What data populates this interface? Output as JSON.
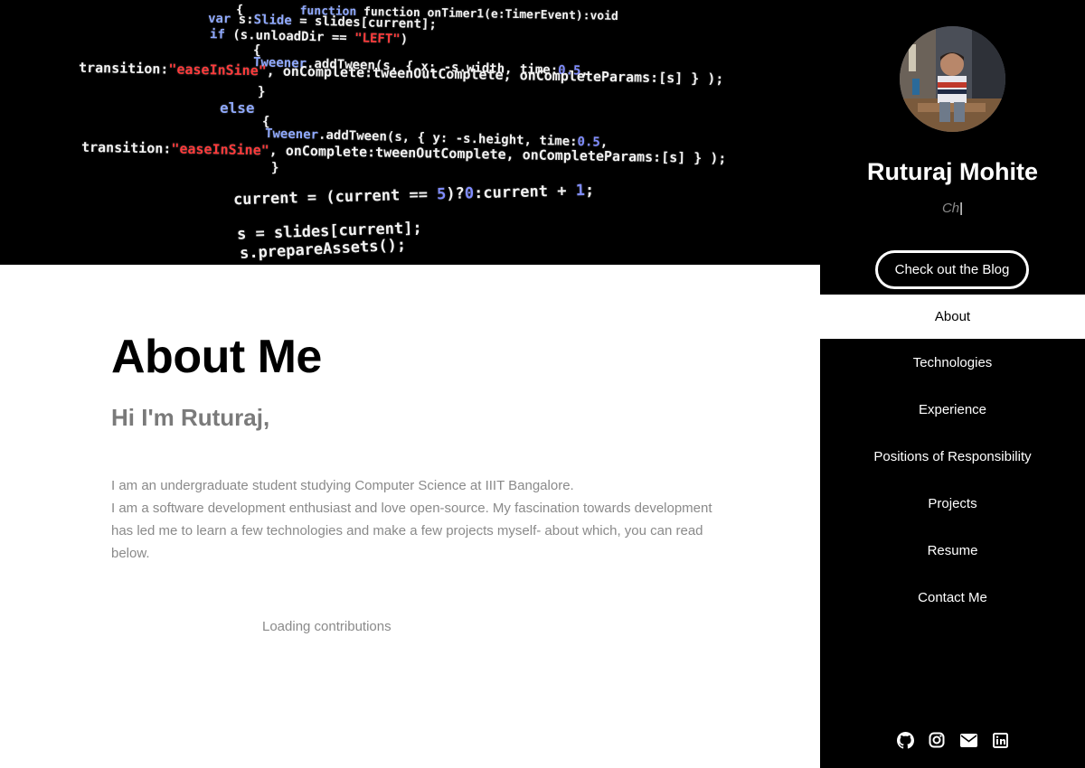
{
  "banner": {
    "code_lines": [
      "function onTimer1(e:TimerEvent):void",
      "var s:Slide = slides[current];",
      "if (s.unloadDir == \"LEFT\")",
      "{",
      "Tweener.addTween(s, { x: -s.width, time:0.5,",
      "transition:\"easeInSine\", onComplete:tweenOutComplete, onCompleteParams:[s] } );",
      "}",
      "else",
      "{",
      "Tweener.addTween(s, { y: -s.height, time:0.5,",
      "transition:\"easeInSine\", onComplete:tweenOutComplete, onCompleteParams:[s] } );",
      "}",
      "current = (current == 5)?0:current + 1;",
      "s = slides[current];",
      "s.prepareAssets();"
    ]
  },
  "about": {
    "title": "About Me",
    "subtitle": "Hi I'm Ruturaj,",
    "line1": "I am an undergraduate student studying Computer Science at IIIT Bangalore.",
    "line2": "I am a software development enthusiast and love open-source. My fascination towards development has led me to learn a few technologies and make a few projects myself- about which, you can read below.",
    "loading": "Loading contributions"
  },
  "sidebar": {
    "avatar": "profile-photo",
    "name": "Ruturaj Mohite",
    "typed_text": "Ch",
    "typed_cursor": "|",
    "blog_button": "Check out the Blog",
    "nav": [
      {
        "label": "About",
        "active": true
      },
      {
        "label": "Technologies",
        "active": false
      },
      {
        "label": "Experience",
        "active": false
      },
      {
        "label": "Positions of Responsibility",
        "active": false
      },
      {
        "label": "Projects",
        "active": false
      },
      {
        "label": "Resume",
        "active": false
      },
      {
        "label": "Contact Me",
        "active": false
      }
    ],
    "social_icons": [
      "github-icon",
      "instagram-icon",
      "envelope-icon",
      "linkedin-icon"
    ]
  },
  "colors": {
    "sidebar_bg": "#000000",
    "accent_text": "#8a8a8a",
    "code_string": "#ff3b3b",
    "code_keyword": "#8fa9ff"
  }
}
